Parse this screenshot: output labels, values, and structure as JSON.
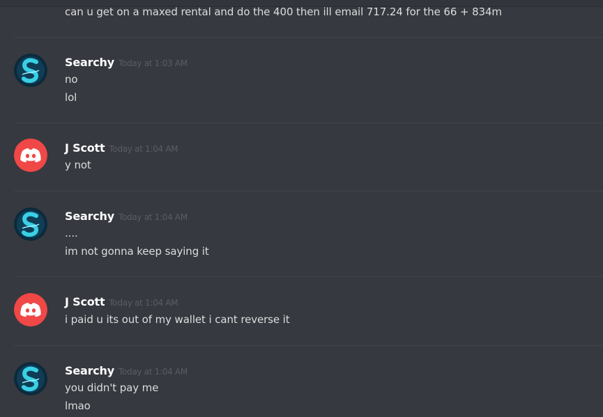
{
  "colors": {
    "background": "#36393f",
    "divider": "#40434a",
    "username": "#ffffff",
    "timestamp": "#5a5d63",
    "message_text": "#dcddde",
    "discord_avatar_red": "#f04747",
    "searchy_avatar_bg": "#0b2a3c",
    "searchy_avatar_cyan": "#39d0e6"
  },
  "icons": {
    "searchy_avatar": "searchy-s-logo-avatar",
    "jscott_avatar": "discord-default-avatar-icon"
  },
  "previous_message": {
    "text": "can u get on a maxed rental and do the 400 then ill email 717.24 for the 66 + 834m"
  },
  "messages": [
    {
      "author": "Searchy",
      "timestamp": "Today at 1:03 AM",
      "lines": [
        "no",
        "lol"
      ]
    },
    {
      "author": "J Scott",
      "timestamp": "Today at 1:04 AM",
      "lines": [
        "y not"
      ]
    },
    {
      "author": "Searchy",
      "timestamp": "Today at 1:04 AM",
      "lines": [
        "....",
        "im not gonna keep saying it"
      ]
    },
    {
      "author": "J Scott",
      "timestamp": "Today at 1:04 AM",
      "lines": [
        "i paid u its out of my wallet i cant reverse it"
      ]
    },
    {
      "author": "Searchy",
      "timestamp": "Today at 1:04 AM",
      "lines": [
        "you didn't pay me",
        "lmao"
      ]
    }
  ]
}
